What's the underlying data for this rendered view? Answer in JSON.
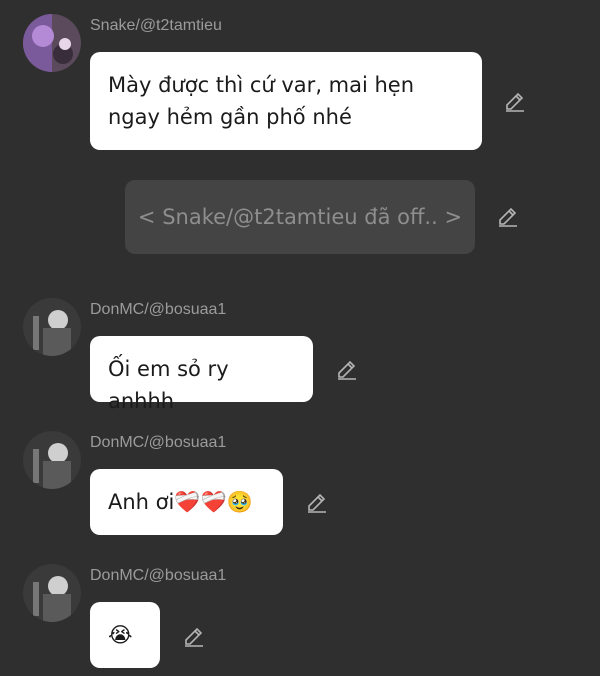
{
  "messages": [
    {
      "username": "Snake/@t2tamtieu",
      "text": "Mày được thì cứ var, mai hẹn ngay hẻm gần phố nhé"
    },
    {
      "system_text": "< Snake/@t2tamtieu đã off.. >"
    },
    {
      "username": "DonMC/@bosuaa1",
      "text": "Ối em sỏ ry anhhh"
    },
    {
      "username": "DonMC/@bosuaa1",
      "text": "Anh ơi❤️‍🩹❤️‍🩹🥹"
    },
    {
      "username": "DonMC/@bosuaa1",
      "text": "😭"
    }
  ],
  "colors": {
    "background": "#2f2f2f",
    "bubble": "#ffffff",
    "system_bubble": "#444444"
  },
  "icons": {
    "edit": "pencil-icon"
  }
}
